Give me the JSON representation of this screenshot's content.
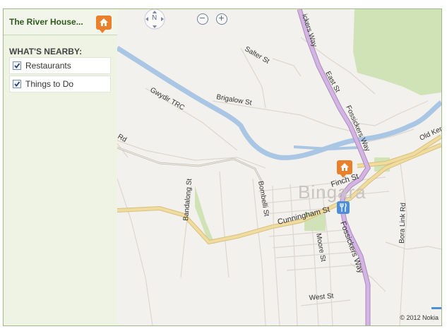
{
  "sidebar": {
    "title": "The River House...",
    "title_icon": "home-pin-icon",
    "nearby_heading": "WHAT'S NEARBY:",
    "items": [
      {
        "label": "Restaurants",
        "checked": true
      },
      {
        "label": "Things to Do",
        "checked": true
      }
    ]
  },
  "map": {
    "compass_label": "N",
    "zoom_out_label": "−",
    "zoom_in_label": "+",
    "town_label": "Bingara",
    "copyright": "© 2012 Nokia",
    "streets": {
      "fossickers_way_top": "ickers Way",
      "east_st": "East St",
      "fossickers_way_mid": "Fossickers Way",
      "salter_st": "Salter St",
      "brigalow_st": "Brigalow St",
      "gwydir_trc": "Gwydir TRC",
      "rd": "Rd",
      "old_ker": "Old Ker",
      "finch_st": "Finch St",
      "bandalong_st": "Bandalong St",
      "bombelli_st": "Bombelli St",
      "cunningham_st": "Cunningham St",
      "fossickers_way_low": "Fossickers Way",
      "bora_link_rd": "Bora Link Rd",
      "moore_st": "Moore St",
      "west_st": "West St"
    },
    "colors": {
      "river": "#a9c6e4",
      "highway": "#c9a7d8",
      "major_road": "#f0dca0",
      "park": "#cfe3b6",
      "accent_pin": "#e8802c",
      "restaurant_marker": "#4d8fd6"
    }
  }
}
